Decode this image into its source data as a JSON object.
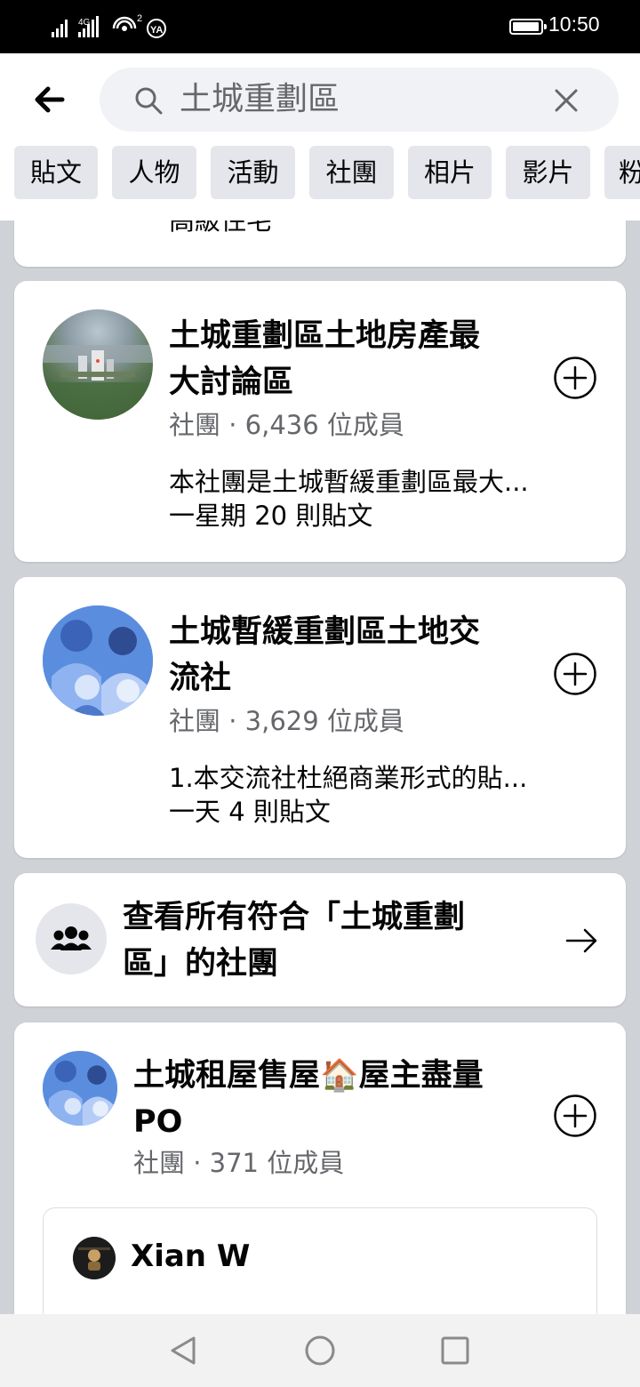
{
  "status_bar": {
    "network": "4G",
    "sim_badge": "2",
    "time": "10:50"
  },
  "search": {
    "query": "土城重劃區"
  },
  "filters": [
    "貼文",
    "人物",
    "活動",
    "社團",
    "相片",
    "影片",
    "粉"
  ],
  "partial_card": {
    "text": "高級住宅"
  },
  "results": [
    {
      "title_line1": "土城重劃區土地房產最",
      "title_line2": "大討論區",
      "meta": "社團 · 6,436 位成員",
      "description": "本社團是土城暫緩重劃區最大...",
      "activity": "一星期 20 則貼文"
    },
    {
      "title_line1": "土城暫緩重劃區土地交",
      "title_line2": "流社",
      "meta": "社團 · 3,629 位成員",
      "description": "1.本交流社杜絕商業形式的貼...",
      "activity": "一天 4 則貼文"
    }
  ],
  "see_all": {
    "line1": "查看所有符合「土城重劃",
    "line2": "區」的社團"
  },
  "third_result": {
    "title_line1": "土城租屋售屋🏠屋主盡量",
    "title_line2": "PO",
    "meta": "社團 · 371 位成員",
    "post_author": "Xian W"
  },
  "colors": {
    "accent": "#050505",
    "secondary_text": "#65676b",
    "chip_bg": "#e4e6eb",
    "search_bg": "#f0f2f5",
    "feed_bg": "#cfd2d7"
  }
}
